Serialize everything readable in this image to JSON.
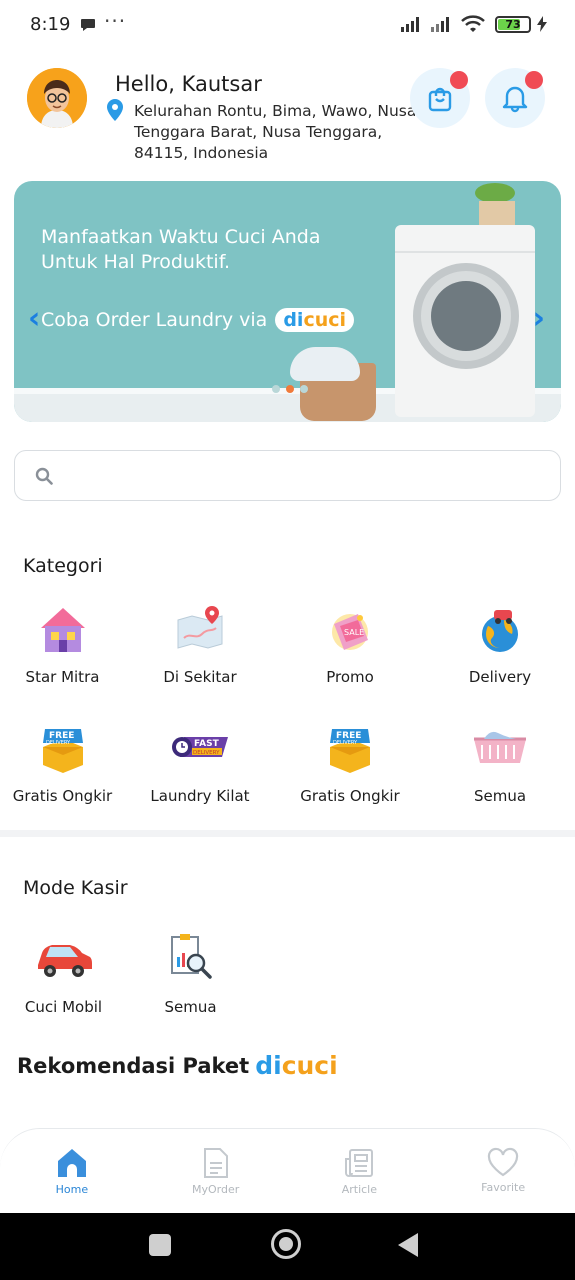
{
  "status": {
    "time": "8:19",
    "battery": "73",
    "more": "···"
  },
  "header": {
    "greeting": "Hello, Kautsar",
    "address": "Kelurahan Rontu, Bima, Wawo, Nusa Tenggara Barat, Nusa Tenggara, 84115, Indonesia"
  },
  "banner": {
    "headline_line1": "Manfaatkan Waktu Cuci Anda",
    "headline_line2": "Untuk Hal Produktif.",
    "cta": "Coba Order Laundry via",
    "brand_di": "di",
    "brand_cuci": "cuci",
    "prev": "‹",
    "next": "›",
    "active_page": 2,
    "page_count": 3
  },
  "search": {
    "placeholder": ""
  },
  "kategori": {
    "title": "Kategori",
    "items": [
      {
        "label": "Star Mitra",
        "icon": "house-icon"
      },
      {
        "label": "Di Sekitar",
        "icon": "map-icon"
      },
      {
        "label": "Promo",
        "icon": "sale-tag-icon"
      },
      {
        "label": "Delivery",
        "icon": "globe-delivery-icon"
      },
      {
        "label": "Gratis Ongkir",
        "icon": "free-delivery-box-icon"
      },
      {
        "label": "Laundry Kilat",
        "icon": "fast-delivery-icon"
      },
      {
        "label": "Gratis Ongkir",
        "icon": "free-delivery-box-icon"
      },
      {
        "label": "Semua",
        "icon": "laundry-basket-icon"
      }
    ]
  },
  "kasir": {
    "title": "Mode Kasir",
    "items": [
      {
        "label": "Cuci Mobil",
        "icon": "car-icon"
      },
      {
        "label": "Semua",
        "icon": "report-search-icon"
      }
    ]
  },
  "rekomendasi": {
    "title": "Rekomendasi Paket",
    "brand_di": "di",
    "brand_cuci": "cuci"
  },
  "nav": {
    "items": [
      {
        "label": "Home",
        "icon": "home-icon",
        "active": true
      },
      {
        "label": "MyOrder",
        "icon": "document-icon",
        "active": false
      },
      {
        "label": "Article",
        "icon": "article-icon",
        "active": false
      },
      {
        "label": "Favorite",
        "icon": "heart-icon",
        "active": false
      }
    ]
  },
  "colors": {
    "accent": "#2a9be6",
    "brand_orange": "#f4a11c",
    "banner_bg": "#7fc3c4",
    "badge_red": "#f04b55"
  }
}
